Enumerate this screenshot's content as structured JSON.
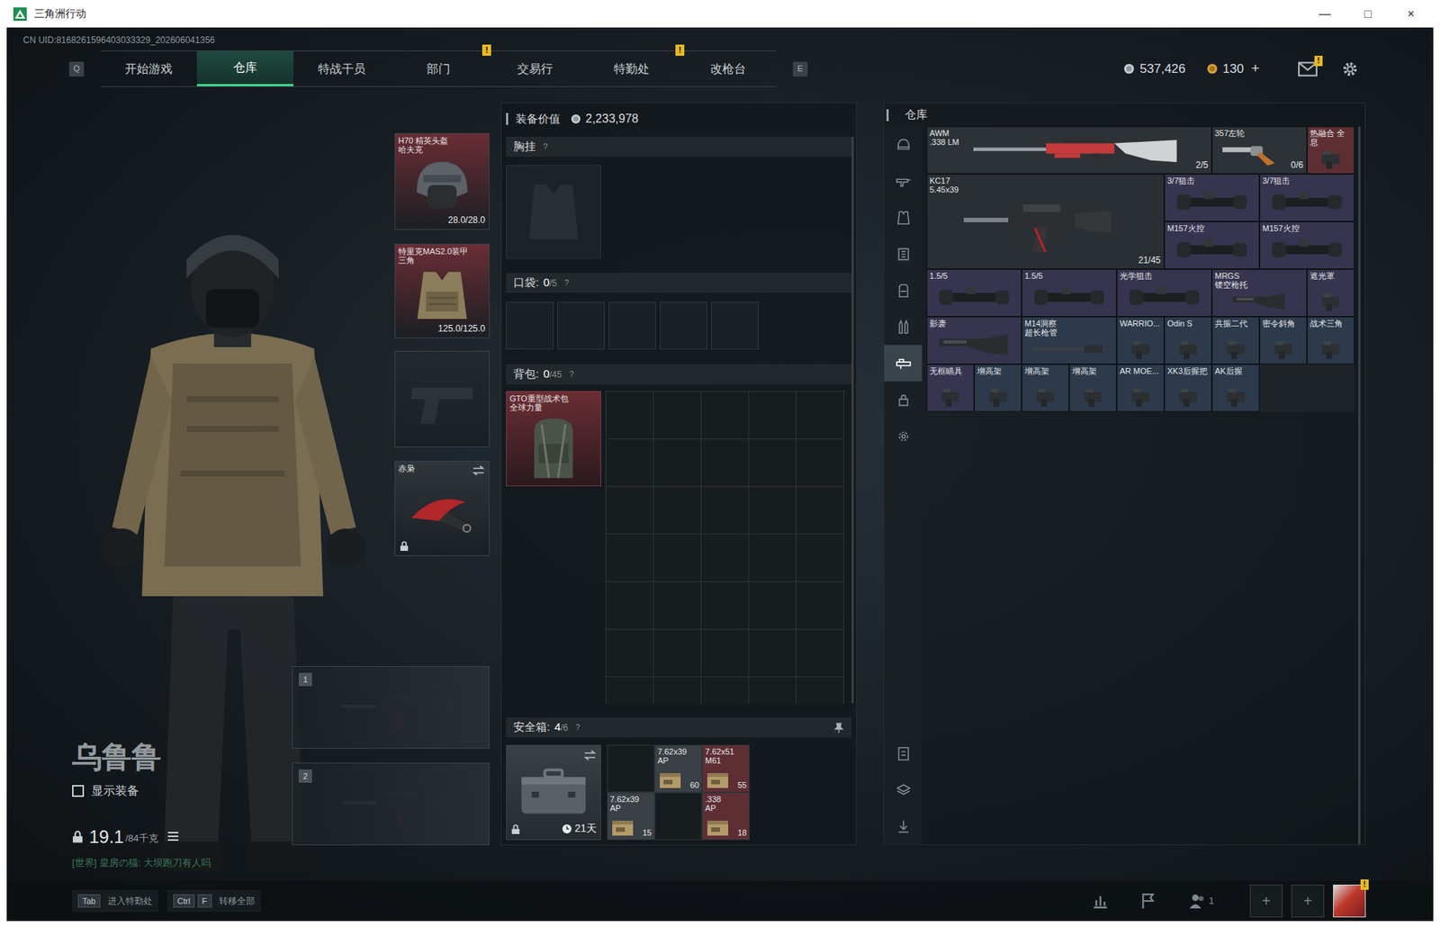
{
  "window": {
    "title": "三角洲行动",
    "controls": [
      "—",
      "□",
      "×"
    ]
  },
  "uid": "CN UID:8168261596403033329_202606041356",
  "nav": {
    "prev_key": "Q",
    "next_key": "E",
    "tabs": [
      {
        "label": "开始游戏",
        "selected": false
      },
      {
        "label": "仓库",
        "selected": true
      },
      {
        "label": "特战干员",
        "selected": false
      },
      {
        "label": "部门",
        "selected": false,
        "badge": "!"
      },
      {
        "label": "交易行",
        "selected": false
      },
      {
        "label": "特勤处",
        "selected": false,
        "badge": "!"
      },
      {
        "label": "改枪台",
        "selected": false
      }
    ]
  },
  "wallet": {
    "coins": "537,426",
    "tickets": "130",
    "add": "+"
  },
  "mail": {
    "badge": "!"
  },
  "character": {
    "name": "乌鲁鲁",
    "show_equipment": {
      "label": "显示装备",
      "checked": false
    },
    "weight": {
      "value": "19.1",
      "max": "/84千克"
    }
  },
  "chat": "[世界] 皇房の猫: 大坝跑刀有人吗",
  "equipment": [
    {
      "kind": "helmet",
      "label": [
        "H70 精英头盔",
        "哈夫克"
      ],
      "durability": "28.0/28.0",
      "color": "#6a2d35"
    },
    {
      "kind": "armor",
      "label": [
        "特里克MAS2.0装甲",
        "三角"
      ],
      "durability": "125.0/125.0",
      "color": "#6a2d35"
    },
    {
      "kind": "pistol",
      "label": [],
      "color": "#222a2e"
    },
    {
      "kind": "melee",
      "label": [
        "赤枭"
      ],
      "color": "#2f363b",
      "locked": true
    }
  ],
  "weapon_slots": [
    {
      "number": "1"
    },
    {
      "number": "2"
    }
  ],
  "loadout": {
    "value_label": "装备价值",
    "value": "2,233,978",
    "chest": {
      "label": "胸挂",
      "help": "?"
    },
    "pocket": {
      "label": "口袋:",
      "count": "0",
      "capacity": "/5",
      "help": "?"
    },
    "backpack": {
      "label": "背包:",
      "count": "0",
      "capacity": "/45",
      "help": "?",
      "item": {
        "label": [
          "GTO重型战术包",
          "全球力量"
        ],
        "color": "#6a2d35"
      }
    },
    "safe": {
      "label": "安全箱:",
      "count": "4",
      "capacity": "/6",
      "help": "?",
      "timer": "21天",
      "locked": true,
      "cells": [
        {
          "kind": "empty"
        },
        {
          "kind": "ammo",
          "label": [
            "7.62x39",
            "AP"
          ],
          "qty": "60",
          "color": "#3a4045"
        },
        {
          "kind": "ammo",
          "label": [
            "7.62x51",
            "M61"
          ],
          "qty": "55",
          "color": "#5e2e35"
        },
        {
          "kind": "ammo",
          "label": [
            "7.62x39",
            "AP"
          ],
          "qty": "15",
          "color": "#3a4045"
        },
        {
          "kind": "empty"
        },
        {
          "kind": "ammo",
          "label": [
            ".338",
            "AP"
          ],
          "qty": "18",
          "color": "#5e2e35"
        }
      ]
    }
  },
  "warehouse": {
    "title": "仓库",
    "tabs": [
      {
        "kind": "helmet",
        "selected": false
      },
      {
        "kind": "weapon",
        "selected": false
      },
      {
        "kind": "armor",
        "selected": false
      },
      {
        "kind": "chest",
        "selected": false
      },
      {
        "kind": "backpack",
        "selected": false
      },
      {
        "kind": "ammo",
        "selected": false
      },
      {
        "kind": "attachment",
        "selected": true
      },
      {
        "kind": "locked",
        "selected": false
      },
      {
        "kind": "settings",
        "selected": false
      }
    ],
    "tools": [
      {
        "kind": "sort"
      },
      {
        "kind": "layers"
      },
      {
        "kind": "transfer"
      }
    ],
    "items": [
      {
        "kind": "sniper",
        "label": [
          "AWM",
          ".338 LM"
        ],
        "count": "2/5",
        "color": "#2d3237"
      },
      {
        "kind": "revolver",
        "label": [
          "357左轮"
        ],
        "count": "0/6",
        "color": "#2d3237"
      },
      {
        "kind": "attachment",
        "label": [
          "热融合 全息"
        ],
        "color": "#5e2e35"
      },
      {
        "kind": "rifle",
        "label": [
          "KC17",
          "5.45x39"
        ],
        "count": "21/45",
        "color": "#2a2f33"
      },
      {
        "kind": "scope",
        "label": [
          "3/7狙击"
        ],
        "color": "#37344f"
      },
      {
        "kind": "scope",
        "label": [
          "3/7狙击"
        ],
        "color": "#37344f"
      },
      {
        "kind": "scope",
        "label": [
          "M157火控"
        ],
        "color": "#37344f"
      },
      {
        "kind": "scope",
        "label": [
          "M157火控"
        ],
        "color": "#37344f"
      },
      {
        "kind": "scope",
        "label": [
          "1.5/5"
        ],
        "color": "#37344f"
      },
      {
        "kind": "scope",
        "label": [
          "1.5/5"
        ],
        "color": "#37344f"
      },
      {
        "kind": "scope",
        "label": [
          "光学狙击"
        ],
        "color": "#37344f"
      },
      {
        "kind": "stock",
        "label": [
          "MRGS",
          "镂空枪托"
        ],
        "color": "#37344f"
      },
      {
        "kind": "attachment",
        "label": [
          "遮光罩"
        ],
        "color": "#37344f"
      },
      {
        "kind": "stock",
        "label": [
          "影袭"
        ],
        "color": "#37344f"
      },
      {
        "kind": "barrel",
        "label": [
          "M14洞察",
          "超长枪管"
        ],
        "color": "#2c3a4c"
      },
      {
        "kind": "attachment",
        "label": [
          "WARRIO..."
        ],
        "color": "#2c3a4c"
      },
      {
        "kind": "attachment",
        "label": [
          "Odin S"
        ],
        "color": "#2c3a4c"
      },
      {
        "kind": "attachment",
        "label": [
          "共振二代"
        ],
        "color": "#2c3a4c"
      },
      {
        "kind": "attachment",
        "label": [
          "密令斜角"
        ],
        "color": "#2c3a4c"
      },
      {
        "kind": "attachment",
        "label": [
          "战术三角"
        ],
        "color": "#2c3a4c"
      },
      {
        "kind": "attachment",
        "label": [
          "无框瞄具"
        ],
        "color": "#37344f"
      },
      {
        "kind": "attachment",
        "label": [
          "增高架"
        ],
        "color": "#2c3a4c"
      },
      {
        "kind": "attachment",
        "label": [
          "增高架"
        ],
        "color": "#2c3a4c"
      },
      {
        "kind": "attachment",
        "label": [
          "增高架"
        ],
        "color": "#2c3a4c"
      },
      {
        "kind": "attachment",
        "label": [
          "AR MOE..."
        ],
        "color": "#2c3a4c"
      },
      {
        "kind": "attachment",
        "label": [
          "XK3后握把"
        ],
        "color": "#2c3a4c"
      },
      {
        "kind": "attachment",
        "label": [
          "AK后握"
        ],
        "color": "#2c3a4c"
      }
    ]
  },
  "bottom_bar": {
    "hints": [
      {
        "keys": [
          "Tab"
        ],
        "label": "进入特勤处"
      },
      {
        "keys": [
          "Ctrl",
          "F"
        ],
        "label": "转移全部"
      }
    ],
    "party_count": "1",
    "add_slots": [
      "+",
      "+"
    ],
    "avatar_badge": "!"
  }
}
